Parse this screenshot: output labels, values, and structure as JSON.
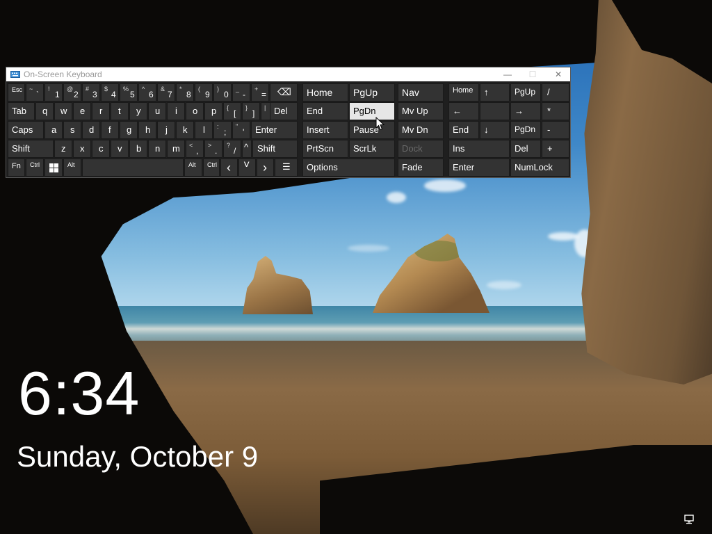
{
  "window": {
    "title": "On-Screen Keyboard",
    "min_glyph": "—",
    "max_glyph": "☐",
    "close_glyph": "✕"
  },
  "keys": {
    "esc": "Esc",
    "tilde_top": "~",
    "tilde_bottom": "`",
    "n1_top": "!",
    "n1": "1",
    "n2_top": "@",
    "n2": "2",
    "n3_top": "#",
    "n3": "3",
    "n4_top": "$",
    "n4": "4",
    "n5_top": "%",
    "n5": "5",
    "n6_top": "^",
    "n6": "6",
    "n7_top": "&",
    "n7": "7",
    "n8_top": "*",
    "n8": "8",
    "n9_top": "(",
    "n9": "9",
    "n0_top": ")",
    "n0": "0",
    "minus_top": "_",
    "minus": "-",
    "plus_top": "+",
    "plus": "=",
    "backspace": "⌫",
    "tab": "Tab",
    "q": "q",
    "w": "w",
    "e": "e",
    "r": "r",
    "t": "t",
    "y": "y",
    "u": "u",
    "i": "i",
    "o": "o",
    "p": "p",
    "lbracket_top": "{",
    "lbracket": "[",
    "rbracket_top": "}",
    "rbracket": "]",
    "backslash_top": "|",
    "backslash": "\\",
    "del": "Del",
    "caps": "Caps",
    "a": "a",
    "s": "s",
    "d": "d",
    "f": "f",
    "g": "g",
    "h": "h",
    "j": "j",
    "k": "k",
    "l": "l",
    "semicolon_top": ":",
    "semicolon": ";",
    "quote_top": "\"",
    "quote": "'",
    "enter": "Enter",
    "shift": "Shift",
    "z": "z",
    "x": "x",
    "c": "c",
    "v": "v",
    "b": "b",
    "n": "n",
    "m": "m",
    "comma_top": "<",
    "comma": ",",
    "period_top": ">",
    "period": ".",
    "slash_top": "?",
    "slash": "/",
    "up_arrow": "^",
    "fn": "Fn",
    "ctrl": "Ctrl",
    "alt": "Alt",
    "left_arrow": "‹",
    "down_arrow": "˅",
    "right_arrow": "›",
    "menu": "☰"
  },
  "nav_keys": {
    "home": "Home",
    "pgup": "PgUp",
    "nav": "Nav",
    "end": "End",
    "pgdn": "PgDn",
    "mvup": "Mv Up",
    "insert": "Insert",
    "pause": "Pause",
    "mvdn": "Mv Dn",
    "prtscn": "PrtScn",
    "scrlk": "ScrLk",
    "dock": "Dock",
    "options": "Options",
    "fade": "Fade"
  },
  "numpad": {
    "home": "Home",
    "up": "↑",
    "pgup": "PgUp",
    "slash": "/",
    "left": "←",
    "right": "→",
    "star": "*",
    "end": "End",
    "down": "↓",
    "pgdn": "PgDn",
    "minus": "-",
    "ins": "Ins",
    "del": "Del",
    "plus": "+",
    "enter": "Enter",
    "numlock": "NumLock"
  },
  "lockscreen": {
    "time": "6:34",
    "date": "Sunday, October 9"
  },
  "colors": {
    "key_bg": "#333333",
    "key_highlight": "#e6e6e6",
    "window_bg": "#1f1f1f"
  }
}
